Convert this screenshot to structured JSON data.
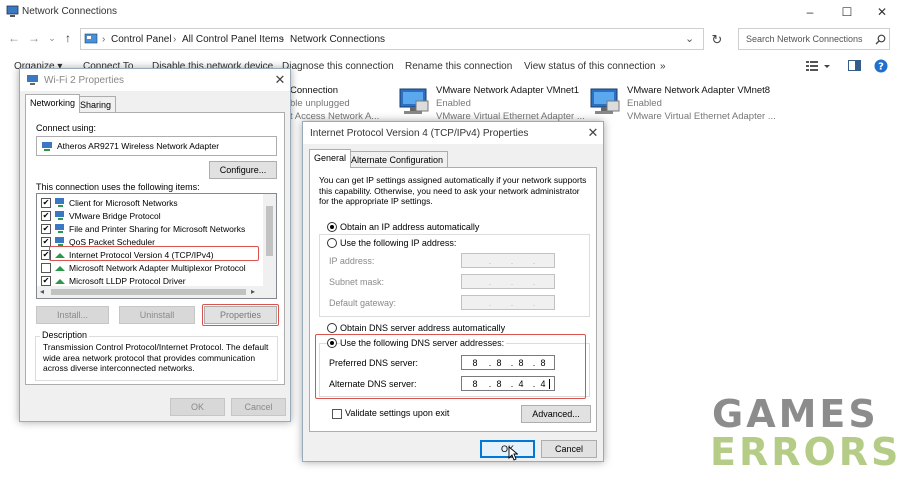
{
  "window": {
    "title": "Network Connections",
    "controls": {
      "minimize": "–",
      "maximize": "☐",
      "close": "✕"
    }
  },
  "nav": {
    "back": "←",
    "forward": "→",
    "recent": "⌄",
    "up": "↑",
    "breadcrumbs": [
      "Control Panel",
      "All Control Panel Items",
      "Network Connections"
    ],
    "separator": "›",
    "dropdown": "⌄",
    "refresh": "↻",
    "search_placeholder": "Search Network Connections"
  },
  "commands": {
    "organize": "Organize ▾",
    "connect_to": "Connect To",
    "disable": "Disable this network device",
    "diagnose": "Diagnose this connection",
    "rename": "Rename this connection",
    "view_status": "View status of this connection",
    "more": "»"
  },
  "adapters": [
    {
      "name": "Connection",
      "status": "ble unplugged",
      "device": "t Access Network A..."
    },
    {
      "name": "VMware Network Adapter VMnet1",
      "status": "Enabled",
      "device": "VMware Virtual Ethernet Adapter ..."
    },
    {
      "name": "VMware Network Adapter VMnet8",
      "status": "Enabled",
      "device": "VMware Virtual Ethernet Adapter ..."
    }
  ],
  "wifi_dialog": {
    "title": "Wi-Fi 2 Properties",
    "tabs": [
      "Networking",
      "Sharing"
    ],
    "connect_using_label": "Connect using:",
    "adapter_name": "Atheros AR9271 Wireless Network Adapter",
    "configure": "Configure...",
    "items_label": "This connection uses the following items:",
    "items": [
      {
        "label": "Client for Microsoft Networks",
        "checked": true
      },
      {
        "label": "VMware Bridge Protocol",
        "checked": true
      },
      {
        "label": "File and Printer Sharing for Microsoft Networks",
        "checked": true
      },
      {
        "label": "QoS Packet Scheduler",
        "checked": true
      },
      {
        "label": "Internet Protocol Version 4 (TCP/IPv4)",
        "checked": true
      },
      {
        "label": "Microsoft Network Adapter Multiplexor Protocol",
        "checked": false
      },
      {
        "label": "Microsoft LLDP Protocol Driver",
        "checked": true
      }
    ],
    "install": "Install...",
    "uninstall": "Uninstall",
    "properties": "Properties",
    "description_label": "Description",
    "description": "Transmission Control Protocol/Internet Protocol. The default wide area network protocol that provides communication across diverse interconnected networks.",
    "ok": "OK",
    "cancel": "Cancel"
  },
  "ipv4_dialog": {
    "title": "Internet Protocol Version 4 (TCP/IPv4) Properties",
    "tabs": [
      "General",
      "Alternate Configuration"
    ],
    "intro": "You can get IP settings assigned automatically if your network supports this capability. Otherwise, you need to ask your network administrator for the appropriate IP settings.",
    "obtain_ip_auto": "Obtain an IP address automatically",
    "use_following_ip": "Use the following IP address:",
    "ip_address_label": "IP address:",
    "subnet_mask_label": "Subnet mask:",
    "default_gateway_label": "Default gateway:",
    "obtain_dns_auto": "Obtain DNS server address automatically",
    "use_following_dns": "Use the following DNS server addresses:",
    "preferred_dns_label": "Preferred DNS server:",
    "preferred_dns": [
      "8",
      "8",
      "8",
      "8"
    ],
    "alternate_dns_label": "Alternate DNS server:",
    "alternate_dns": [
      "8",
      "8",
      "4",
      "4"
    ],
    "validate_on_exit": "Validate settings upon exit",
    "advanced": "Advanced...",
    "ok": "OK",
    "cancel": "Cancel"
  },
  "watermark": {
    "line1": "GAMES",
    "line2": "ERRORS"
  },
  "colors": {
    "accent": "#0078d7",
    "highlight_box": "#d9534f",
    "watermark_gray": "#8c8c8c",
    "watermark_green": "#b5cc86"
  }
}
